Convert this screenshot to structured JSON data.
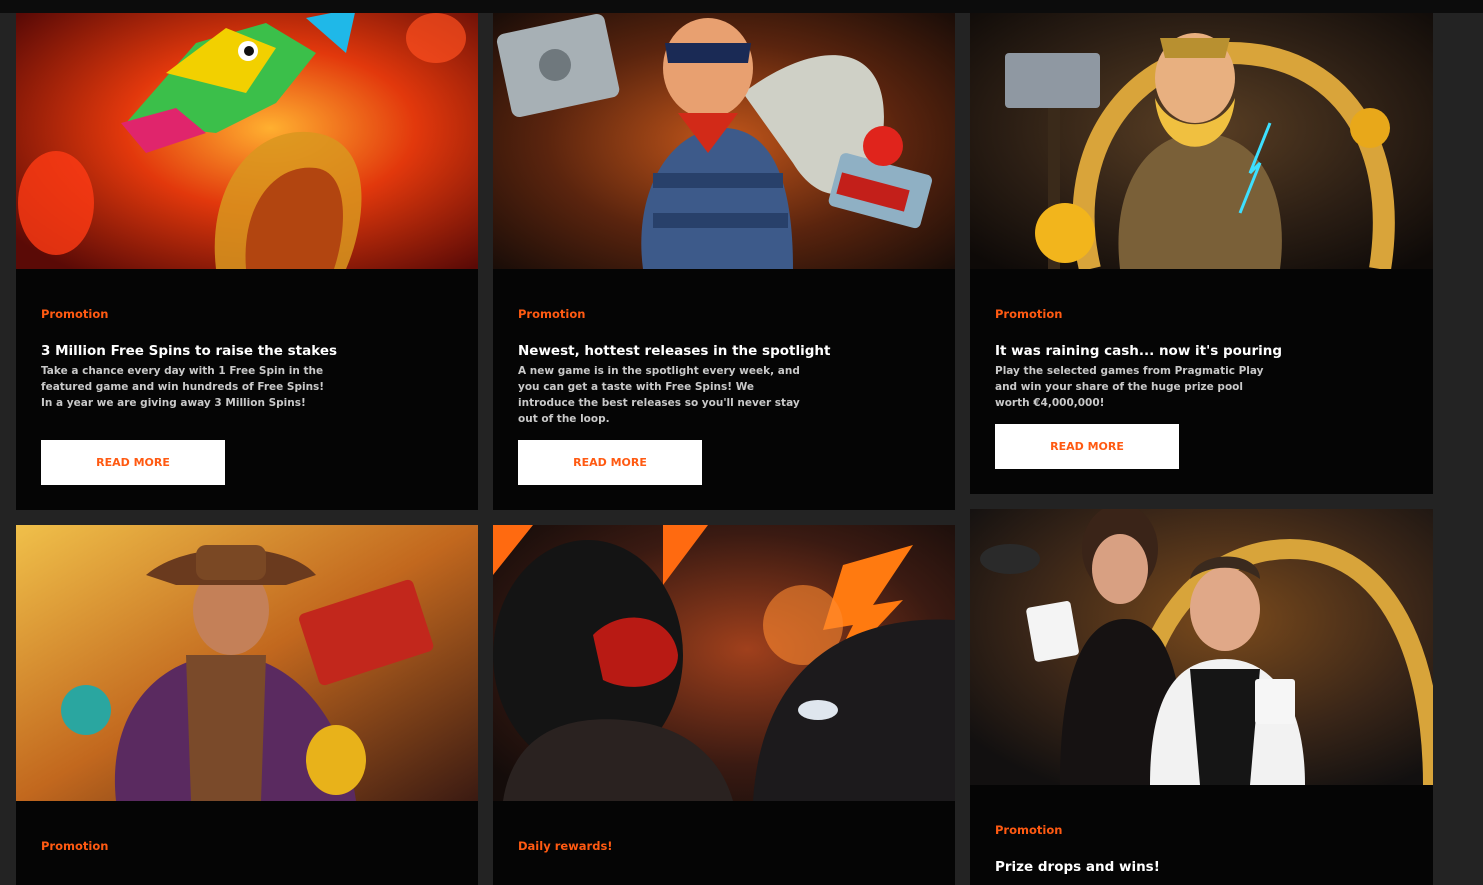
{
  "colors": {
    "accent": "#ff5a12",
    "card_bg": "#050505",
    "page_bg": "#232323",
    "button_bg": "#ffffff"
  },
  "cards": [
    {
      "category": "Promotion",
      "title": "3 Million Free Spins to raise the stakes",
      "description": "Take a chance every day with 1 Free Spin in the featured game and win hundreds of Free Spins! In a year we are giving away 3 Million Spins!",
      "button": "READ MORE",
      "image": "dragon-slot-artwork"
    },
    {
      "category": "Promotion",
      "title": "Newest, hottest releases in the spotlight",
      "description": "A new game is in the spotlight every week, and you can get a taste with Free Spins! We introduce the best releases so you'll never stay out of the loop.",
      "button": "READ MORE",
      "image": "burglar-slot-artwork"
    },
    {
      "category": "Promotion",
      "title": "It was raining cash... now it's pouring",
      "description": "Play the selected games from Pragmatic Play and win your share of the huge prize pool worth €4,000,000!",
      "button": "READ MORE",
      "image": "viking-slot-artwork"
    },
    {
      "category": "Promotion",
      "image": "explorer-slot-artwork"
    },
    {
      "category": "Daily rewards!",
      "image": "nitro-racer-artwork"
    },
    {
      "category": "Promotion",
      "title": "Prize drops and wins!",
      "image": "live-casino-dealers-artwork"
    }
  ]
}
